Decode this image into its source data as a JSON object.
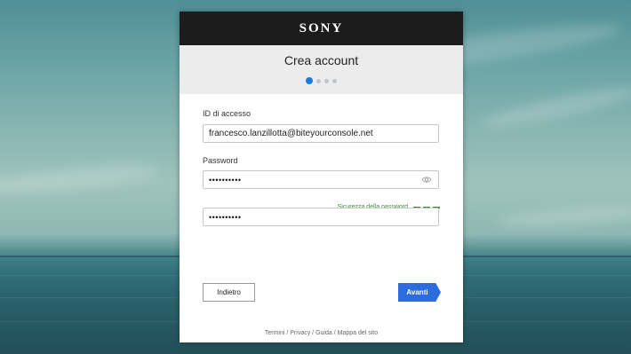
{
  "brand": {
    "logo_text": "SONY"
  },
  "header": {
    "title": "Crea account"
  },
  "steps": {
    "total": 4,
    "current": 1
  },
  "form": {
    "id_label": "ID di accesso",
    "id_value": "francesco.lanzillotta@biteyourconsole.net",
    "password_label": "Password",
    "password_value": "••••••••••",
    "confirm_value": "••••••••••",
    "strength_label": "Sicurezza della password"
  },
  "buttons": {
    "back_label": "Indietro",
    "next_label": "Avanti"
  },
  "footer": {
    "links": [
      "Termini",
      "Privacy",
      "Guida",
      "Mappa del sito"
    ],
    "separator": "/"
  },
  "colors": {
    "accent": "#2d6cdf",
    "step_active": "#1a7bd9",
    "strength": "#3a8a35",
    "brand_bar": "#1c1c1c"
  }
}
